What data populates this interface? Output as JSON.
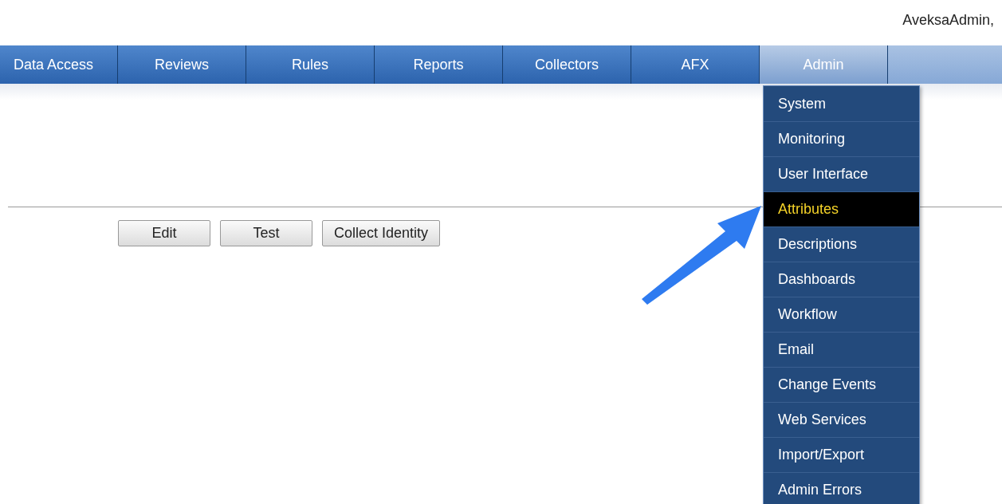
{
  "header": {
    "user": "AveksaAdmin,"
  },
  "nav": {
    "tabs": [
      {
        "label": "Data Access",
        "selected": false
      },
      {
        "label": "Reviews",
        "selected": false
      },
      {
        "label": "Rules",
        "selected": false
      },
      {
        "label": "Reports",
        "selected": false
      },
      {
        "label": "Collectors",
        "selected": false
      },
      {
        "label": "AFX",
        "selected": false
      },
      {
        "label": "Admin",
        "selected": true
      }
    ]
  },
  "admin_menu": {
    "items": [
      {
        "label": "System",
        "selected": false
      },
      {
        "label": "Monitoring",
        "selected": false
      },
      {
        "label": "User Interface",
        "selected": false
      },
      {
        "label": "Attributes",
        "selected": true
      },
      {
        "label": "Descriptions",
        "selected": false
      },
      {
        "label": "Dashboards",
        "selected": false
      },
      {
        "label": "Workflow",
        "selected": false
      },
      {
        "label": "Email",
        "selected": false
      },
      {
        "label": "Change Events",
        "selected": false
      },
      {
        "label": "Web Services",
        "selected": false
      },
      {
        "label": "Import/Export",
        "selected": false
      },
      {
        "label": "Admin Errors",
        "selected": false
      }
    ]
  },
  "buttons": [
    "Edit",
    "Test",
    "Collect Identity"
  ]
}
